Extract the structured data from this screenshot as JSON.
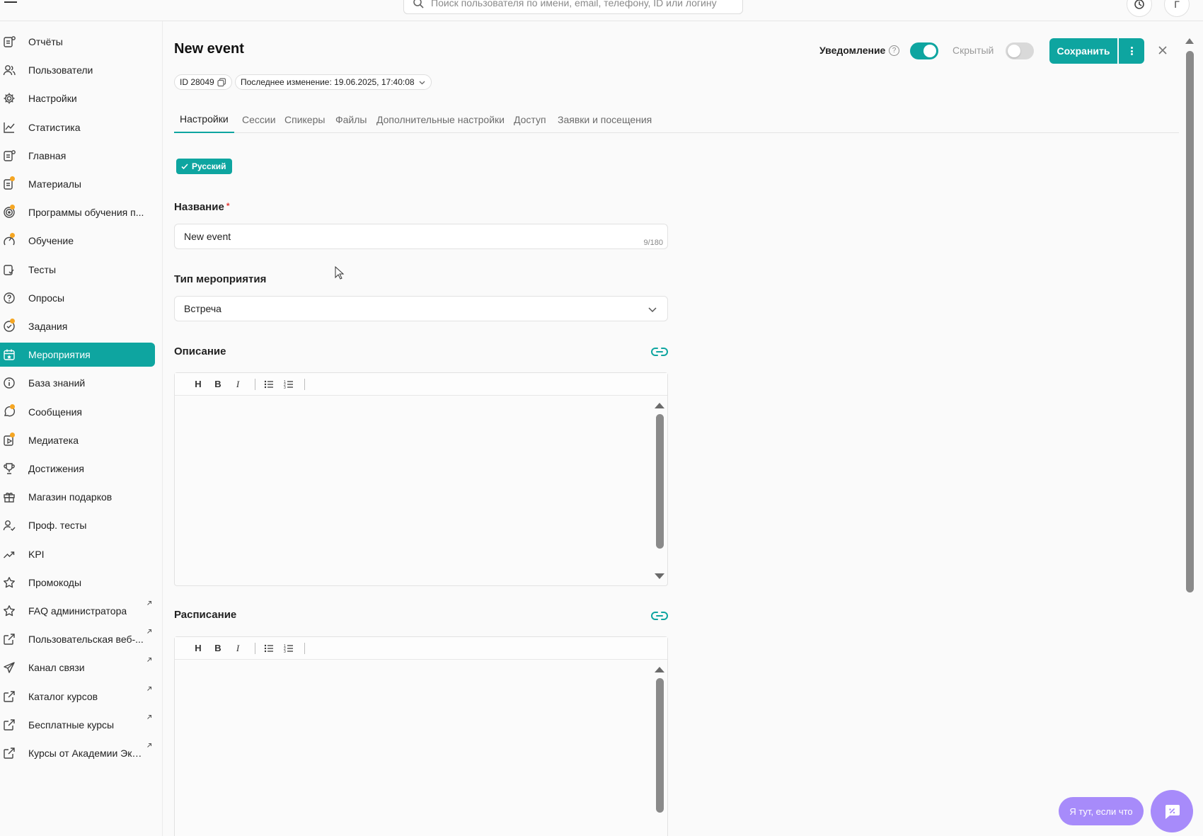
{
  "colors": {
    "accent": "#0ea5a0",
    "help": "#a78bfa",
    "required": "#e53935"
  },
  "search": {
    "placeholder": "Поиск пользователя по имени, email, телефону, ID или логину"
  },
  "topbar": {
    "profile_initial": "Г"
  },
  "sidebar": {
    "items": [
      {
        "label": "Отчёты",
        "icon": "report-icon"
      },
      {
        "label": "Пользователи",
        "icon": "users-icon"
      },
      {
        "label": "Настройки",
        "icon": "gear-icon"
      },
      {
        "label": "Статистика",
        "icon": "chart-icon"
      },
      {
        "label": "Главная",
        "icon": "home-icon"
      },
      {
        "label": "Материалы",
        "icon": "materials-icon"
      },
      {
        "label": "Программы обучения п...",
        "icon": "target-icon"
      },
      {
        "label": "Обучение",
        "icon": "learning-icon"
      },
      {
        "label": "Тесты",
        "icon": "test-icon"
      },
      {
        "label": "Опросы",
        "icon": "survey-icon"
      },
      {
        "label": "Задания",
        "icon": "task-icon"
      },
      {
        "label": "Мероприятия",
        "icon": "calendar-icon",
        "active": true
      },
      {
        "label": "База знаний",
        "icon": "info-icon"
      },
      {
        "label": "Сообщения",
        "icon": "chat-icon"
      },
      {
        "label": "Медиатека",
        "icon": "media-icon"
      },
      {
        "label": "Достижения",
        "icon": "trophy-icon"
      },
      {
        "label": "Магазин подарков",
        "icon": "gift-icon"
      },
      {
        "label": "Проф. тесты",
        "icon": "user-check-icon"
      },
      {
        "label": "KPI",
        "icon": "trend-icon"
      },
      {
        "label": "Промокоды",
        "icon": "star-icon"
      },
      {
        "label": "FAQ администратора",
        "icon": "star-icon",
        "external": true
      },
      {
        "label": "Пользовательская веб-...",
        "icon": "external-link-icon",
        "external": true
      },
      {
        "label": "Канал связи",
        "icon": "send-icon",
        "external": true
      },
      {
        "label": "Каталог курсов",
        "icon": "external-link-icon",
        "external": true
      },
      {
        "label": "Бесплатные курсы",
        "icon": "external-link-icon",
        "external": true
      },
      {
        "label": "Курсы от Академии Экв...",
        "icon": "external-link-icon",
        "external": true
      }
    ]
  },
  "header": {
    "title": "New event",
    "id_chip": "ID 28049",
    "last_change": "Последнее изменение: 19.06.2025, 17:40:08",
    "notification_label": "Уведомление",
    "notification_on": true,
    "hidden_label": "Скрытый",
    "hidden_on": false,
    "save_label": "Сохранить"
  },
  "tabs": [
    {
      "label": "Настройки",
      "active": true
    },
    {
      "label": "Сессии"
    },
    {
      "label": "Спикеры"
    },
    {
      "label": "Файлы"
    },
    {
      "label": "Дополнительные настройки"
    },
    {
      "label": "Доступ"
    },
    {
      "label": "Заявки и посещения"
    }
  ],
  "form": {
    "language": "Русский",
    "name_label": "Название",
    "name_required_mark": "*",
    "name_value": "New event",
    "name_counter": "9/180",
    "type_label": "Тип мероприятия",
    "type_value": "Встреча",
    "description_label": "Описание",
    "schedule_label": "Расписание",
    "toolbar": {
      "heading": "H",
      "bold": "B",
      "italic": "I"
    }
  },
  "help_widget": {
    "label": "Я тут, если что"
  }
}
